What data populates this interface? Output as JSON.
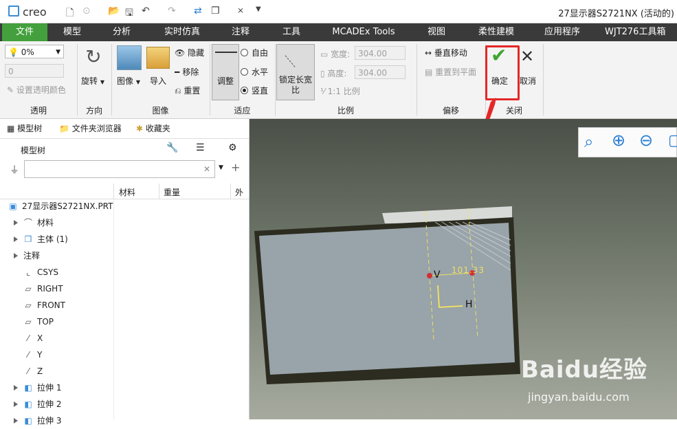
{
  "app": {
    "logo_text": "creo",
    "window_title": "27显示器S2721NX (活动的)"
  },
  "menus": [
    "文件",
    "模型",
    "分析",
    "实时仿真",
    "注释",
    "工具",
    "MCADEx Tools",
    "视图",
    "柔性建模",
    "应用程序",
    "WJT276工具箱"
  ],
  "ribbon": {
    "transparency": {
      "value": "0%",
      "field2": "0",
      "set_color_label": "设置透明颜色",
      "group": "透明"
    },
    "direction": {
      "rotate_label": "旋转",
      "group": "方向"
    },
    "image": {
      "image_label": "图像",
      "import_label": "导入",
      "hide_label": "隐藏",
      "remove_label": "移除",
      "reset_label": "重置",
      "group": "图像"
    },
    "fit": {
      "adjust_label": "调整",
      "free_label": "自由",
      "horizontal_label": "水平",
      "vertical_label": "竖直",
      "group": "适应"
    },
    "scale": {
      "lock_label": "锁定长宽比",
      "width_label": "宽度:",
      "width_value": "304.00",
      "height_label": "高度:",
      "height_value": "304.00",
      "ratio_label": "1:1 比例",
      "group": "比例"
    },
    "offset": {
      "vertical_move_label": "垂直移动",
      "reset_plane_label": "重置到平面",
      "group": "偏移"
    },
    "close": {
      "ok_label": "确定",
      "cancel_label": "取消",
      "group": "关闭"
    }
  },
  "left_panel": {
    "tabs": [
      "模型树",
      "文件夹浏览器",
      "收藏夹"
    ],
    "header": "模型树",
    "columns": [
      "材料",
      "重量",
      "外"
    ],
    "tree": [
      {
        "label": "27显示器S2721NX.PRT",
        "icon": "part-icon",
        "expand": false,
        "indent": 0
      },
      {
        "label": "材料",
        "icon": "material-icon",
        "expand": true,
        "indent": 1
      },
      {
        "label": "主体 (1)",
        "icon": "body-icon",
        "expand": true,
        "indent": 1
      },
      {
        "label": "注释",
        "icon": "",
        "expand": true,
        "indent": 1
      },
      {
        "label": "CSYS",
        "icon": "csys-icon",
        "expand": false,
        "indent": 1
      },
      {
        "label": "RIGHT",
        "icon": "plane-icon",
        "expand": false,
        "indent": 1
      },
      {
        "label": "FRONT",
        "icon": "plane-icon",
        "expand": false,
        "indent": 1
      },
      {
        "label": "TOP",
        "icon": "plane-icon",
        "expand": false,
        "indent": 1
      },
      {
        "label": "X",
        "icon": "axis-icon",
        "expand": false,
        "indent": 1
      },
      {
        "label": "Y",
        "icon": "axis-icon",
        "expand": false,
        "indent": 1
      },
      {
        "label": "Z",
        "icon": "axis-icon",
        "expand": false,
        "indent": 1
      },
      {
        "label": "拉伸 1",
        "icon": "extrude-icon",
        "expand": true,
        "indent": 1
      },
      {
        "label": "拉伸 2",
        "icon": "extrude-icon",
        "expand": true,
        "indent": 1
      },
      {
        "label": "拉伸 3",
        "icon": "extrude-icon",
        "expand": true,
        "indent": 1
      }
    ]
  },
  "viewport": {
    "dimension_text": "101.33",
    "label_v": "V",
    "label_h": "H"
  },
  "watermark": {
    "line1": "Baidu经验",
    "line2": "jingyan.baidu.com"
  },
  "colors": {
    "accent": "#44a03c",
    "menubar": "#3a3a3a",
    "callout": "#e62626"
  }
}
